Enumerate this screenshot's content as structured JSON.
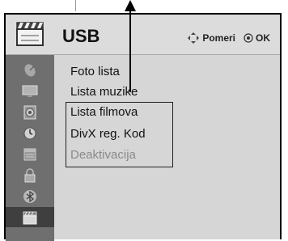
{
  "header": {
    "title": "USB",
    "hint_move": "Pomeri",
    "hint_ok": "OK",
    "icon": "clapperboard-icon"
  },
  "sidebar": {
    "items": [
      {
        "icon": "satellite-dish-icon",
        "active": false
      },
      {
        "icon": "monitor-icon",
        "active": false
      },
      {
        "icon": "speaker-icon",
        "active": false
      },
      {
        "icon": "clock-icon",
        "active": false
      },
      {
        "icon": "calendar-icon",
        "active": false
      },
      {
        "icon": "padlock-icon",
        "active": false
      },
      {
        "icon": "bluetooth-icon",
        "active": false
      },
      {
        "icon": "clapperboard-icon",
        "active": true
      }
    ]
  },
  "menu": {
    "items": [
      {
        "label": "Foto lista",
        "enabled": true
      },
      {
        "label": "Lista muzike",
        "enabled": true
      },
      {
        "label": "Lista filmova",
        "enabled": true
      },
      {
        "label": "DivX reg. Kod",
        "enabled": true
      },
      {
        "label": "Deaktivacija",
        "enabled": false
      }
    ]
  },
  "colors": {
    "sidebar": "#6f6f6f",
    "sidebar_active": "#3f3f3f",
    "panel": "#d6d6d6",
    "disabled_text": "#8a8a8a"
  }
}
